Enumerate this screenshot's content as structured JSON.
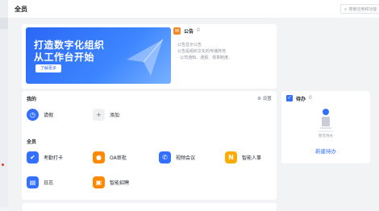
{
  "topbar": {
    "title": "全员",
    "search_placeholder": "搜索应用和功能"
  },
  "banner": {
    "line1": "打造数字化组织",
    "line2": "从工作台开始",
    "button": "了解更多"
  },
  "notice": {
    "title": "公告",
    "count": "0",
    "lines": [
      "公告显示公告",
      "公告是组织文化的传播阵地",
      "· 公司通知、通报、规章制度、"
    ]
  },
  "apps": {
    "mine_label": "我的",
    "settings_label": "设置",
    "mine": [
      {
        "label": "请假",
        "icon": "clock-icon",
        "color": "#3370ff"
      },
      {
        "label": "添加",
        "icon": "plus-icon",
        "color": "#eff0f1"
      }
    ],
    "all_label": "全员",
    "all": [
      {
        "label": "考勤打卡",
        "icon": "location-check-icon",
        "color": "#3370ff"
      },
      {
        "label": "OA审批",
        "icon": "person-approve-icon",
        "color": "#ff8800"
      },
      {
        "label": "视频会议",
        "icon": "phone-icon",
        "color": "#3370ff"
      },
      {
        "label": "智能人事",
        "icon": "n-icon",
        "color": "#ffaa00"
      },
      {
        "label": "日志",
        "icon": "document-icon",
        "color": "#3370ff"
      },
      {
        "label": "智能招聘",
        "icon": "briefcase-icon",
        "color": "#ff8800"
      }
    ]
  },
  "todo": {
    "title": "待办",
    "count": "0",
    "empty": "暂无待办",
    "new_button": "新建待办"
  },
  "colors": {
    "accent": "#3370ff",
    "orange": "#ff8800",
    "background": "#f2f3f5"
  }
}
